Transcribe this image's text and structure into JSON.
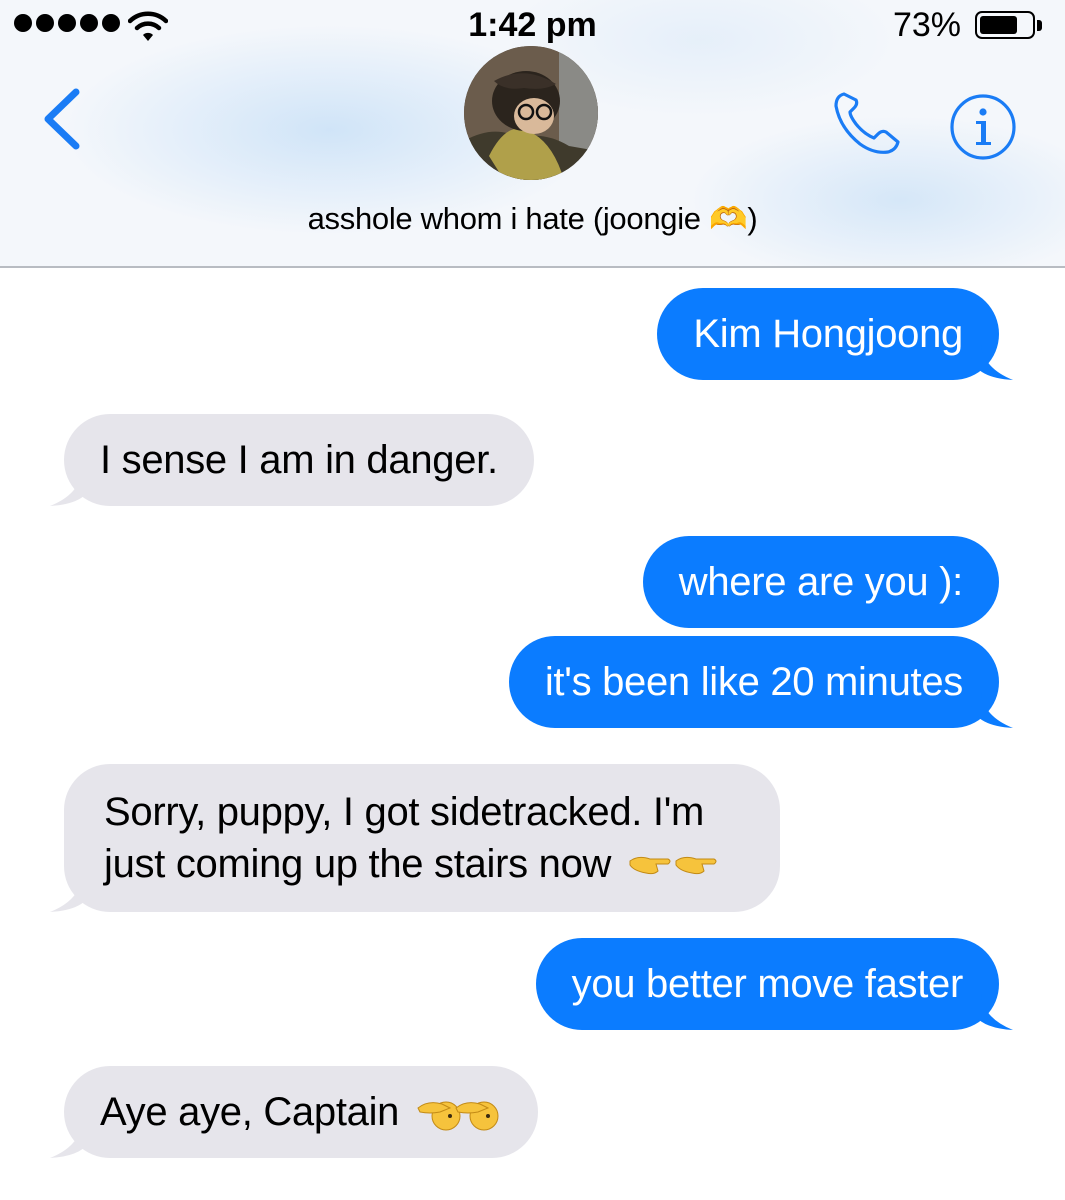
{
  "status_bar": {
    "time": "1:42 pm",
    "battery_percent_text": "73%",
    "battery_level": 0.73,
    "signal_icon": "signal-dots-icon",
    "wifi_icon": "wifi-icon"
  },
  "header": {
    "contact_name": "asshole whom i hate (joongie 🫶)",
    "back_icon": "chevron-left-icon",
    "call_icon": "phone-icon",
    "info_icon": "info-icon",
    "accent_color": "#1a7cf5"
  },
  "messages": [
    {
      "direction": "outgoing",
      "text": "Kim Hongjoong"
    },
    {
      "direction": "incoming",
      "text": "I sense I am in danger."
    },
    {
      "direction": "outgoing",
      "text": "where are you ):"
    },
    {
      "direction": "outgoing",
      "text": "it's been like 20 minutes"
    },
    {
      "direction": "incoming",
      "text": "Sorry, puppy, I got sidetracked. I'm just coming up the stairs now",
      "emoji_icon": "pointing-hands-icon"
    },
    {
      "direction": "outgoing",
      "text": "you better move faster"
    },
    {
      "direction": "incoming",
      "text": "Aye aye, Captain",
      "emoji_icon": "saluting-face-icon"
    }
  ],
  "colors": {
    "outgoing_bubble": "#0b7cff",
    "incoming_bubble": "#e6e5eb"
  }
}
